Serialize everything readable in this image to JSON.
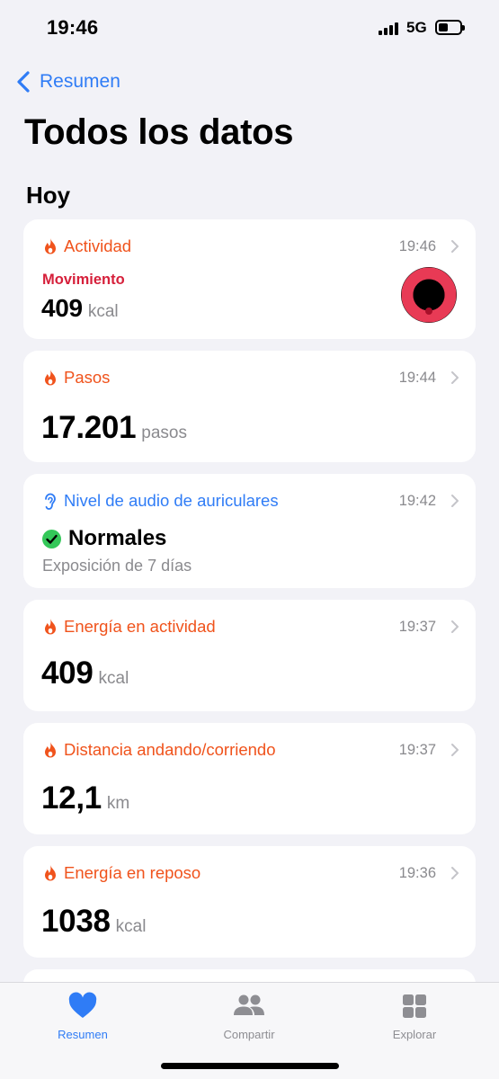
{
  "status_bar": {
    "time": "19:46",
    "network": "5G",
    "battery_level": 0.45
  },
  "nav": {
    "back_label": "Resumen",
    "title": "Todos los datos",
    "section": "Hoy"
  },
  "cards": [
    {
      "title": "Actividad",
      "time": "19:46",
      "label": "Movimiento",
      "value": "409",
      "unit": "kcal",
      "icon": "flame-icon"
    },
    {
      "title": "Pasos",
      "time": "19:44",
      "value": "17.201",
      "unit": "pasos",
      "icon": "flame-icon"
    },
    {
      "title": "Nivel de audio de auriculares",
      "time": "19:42",
      "status": "Normales",
      "subtitle": "Exposición de 7 días",
      "icon": "ear-icon"
    },
    {
      "title": "Energía en actividad",
      "time": "19:37",
      "value": "409",
      "unit": "kcal",
      "icon": "flame-icon"
    },
    {
      "title": "Distancia andando/corriendo",
      "time": "19:37",
      "value": "12,1",
      "unit": "km",
      "icon": "flame-icon"
    },
    {
      "title": "Energía en reposo",
      "time": "19:36",
      "value": "1038",
      "unit": "kcal",
      "icon": "flame-icon"
    }
  ],
  "tab_bar": {
    "tabs": [
      {
        "label": "Resumen",
        "icon": "heart-icon",
        "active": true
      },
      {
        "label": "Compartir",
        "icon": "people-icon",
        "active": false
      },
      {
        "label": "Explorar",
        "icon": "grid-icon",
        "active": false
      }
    ]
  },
  "colors": {
    "accent": "#2f7cf6",
    "activity": "#f0531c",
    "move": "#d6203b",
    "background": "#f2f2f7"
  }
}
